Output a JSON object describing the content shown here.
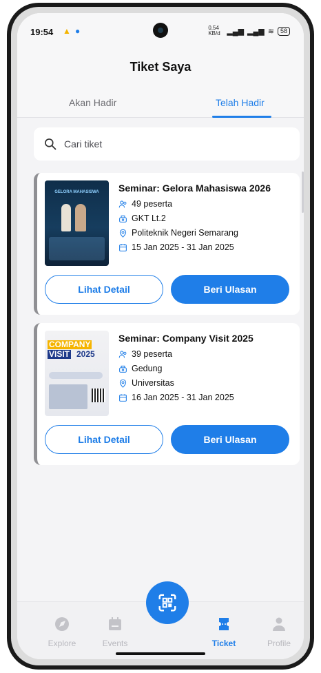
{
  "status_bar": {
    "time": "19:54",
    "net_speed": "0,54 KB/d",
    "battery": "58"
  },
  "page": {
    "title": "Tiket Saya"
  },
  "tabs": [
    {
      "label": "Akan Hadir",
      "active": false
    },
    {
      "label": "Telah Hadir",
      "active": true
    }
  ],
  "search": {
    "placeholder": "Cari tiket"
  },
  "tickets": [
    {
      "title": "Seminar: Gelora Mahasiswa 2026",
      "participants": "49 peserta",
      "room": "GKT Lt.2",
      "location": "Politeknik Negeri Semarang",
      "date": "15 Jan 2025 - 31 Jan 2025",
      "poster_text": "GELORA MAHASISWA",
      "detail_label": "Lihat Detail",
      "review_label": "Beri Ulasan"
    },
    {
      "title": "Seminar: Company Visit 2025",
      "participants": "39 peserta",
      "room": "Gedung",
      "location": "Universitas",
      "date": "16 Jan 2025 - 31 Jan 2025",
      "poster_text_1": "COMPANY",
      "poster_text_2": "VISIT",
      "poster_text_3": "2025",
      "detail_label": "Lihat Detail",
      "review_label": "Beri Ulasan"
    }
  ],
  "bottom_nav": [
    {
      "label": "Explore",
      "icon": "compass-icon",
      "active": false
    },
    {
      "label": "Events",
      "icon": "calendar-icon",
      "active": false
    },
    {
      "label": "Ticket",
      "icon": "ticket-icon",
      "active": true
    },
    {
      "label": "Profile",
      "icon": "person-icon",
      "active": false
    }
  ],
  "colors": {
    "accent": "#1f7ee8",
    "card_border": "#909094",
    "background": "#f4f4f6"
  }
}
